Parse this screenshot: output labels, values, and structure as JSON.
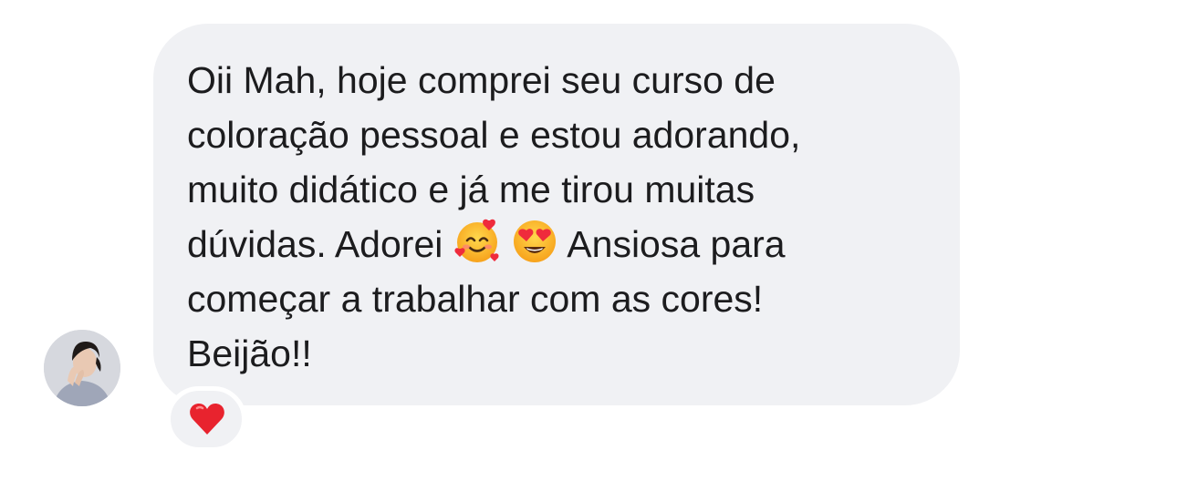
{
  "message": {
    "lines": [
      "Oii Mah, hoje comprei seu curso de",
      "coloração pessoal e estou adorando,",
      "muito didático e já me tirou muitas"
    ],
    "line4_before": "dúvidas. Adorei",
    "line4_after": " Ansiosa para",
    "line5": "começar a trabalhar com as cores!",
    "line6": "Beijão!!",
    "emojis": [
      "smiling-face-with-hearts-icon",
      "heart-eyes-icon"
    ]
  },
  "reaction": {
    "icon": "red-heart-icon"
  },
  "colors": {
    "bubble": "#f0f1f4",
    "text": "#1c1c1e",
    "heart": "#e8232e"
  }
}
